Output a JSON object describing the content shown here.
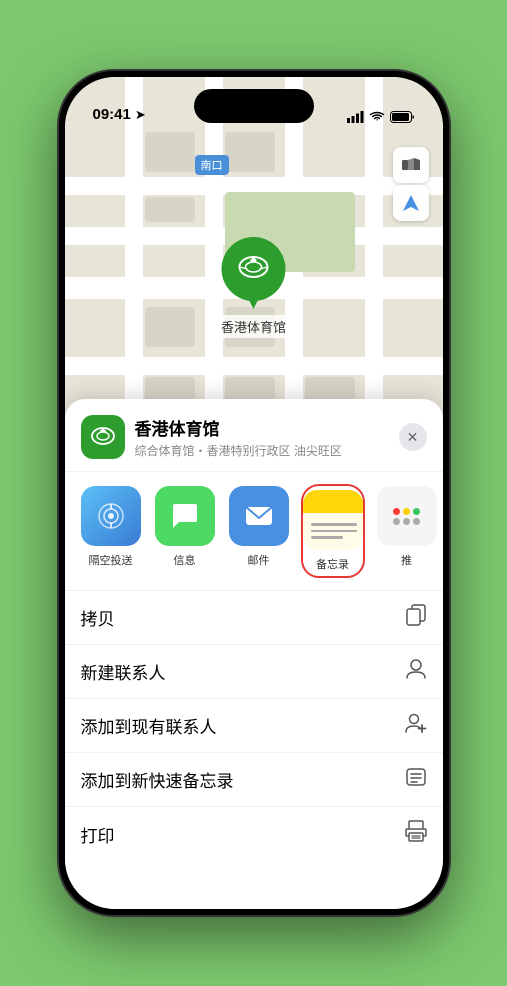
{
  "status_bar": {
    "time": "09:41",
    "signal_bars": "▋▋▋",
    "wifi": "wifi",
    "battery": "battery"
  },
  "map": {
    "label_south": "南口",
    "pin_name": "香港体育馆",
    "controls": {
      "map_icon": "🗺",
      "location_icon": "➤"
    }
  },
  "venue": {
    "name": "香港体育馆",
    "subtitle": "综合体育馆・香港特别行政区 油尖旺区"
  },
  "share_items": [
    {
      "id": "airdrop",
      "label": "隔空投送",
      "style": "airdrop"
    },
    {
      "id": "message",
      "label": "信息",
      "style": "message"
    },
    {
      "id": "mail",
      "label": "邮件",
      "style": "mail"
    },
    {
      "id": "notes",
      "label": "备忘录",
      "style": "notes"
    },
    {
      "id": "more",
      "label": "推",
      "style": "more"
    }
  ],
  "menu_items": [
    {
      "id": "copy",
      "label": "拷贝",
      "icon": "copy"
    },
    {
      "id": "new-contact",
      "label": "新建联系人",
      "icon": "person"
    },
    {
      "id": "add-existing",
      "label": "添加到现有联系人",
      "icon": "person-add"
    },
    {
      "id": "quick-note",
      "label": "添加到新快速备忘录",
      "icon": "quick-note"
    },
    {
      "id": "print",
      "label": "打印",
      "icon": "print"
    }
  ],
  "close_button_label": "✕"
}
